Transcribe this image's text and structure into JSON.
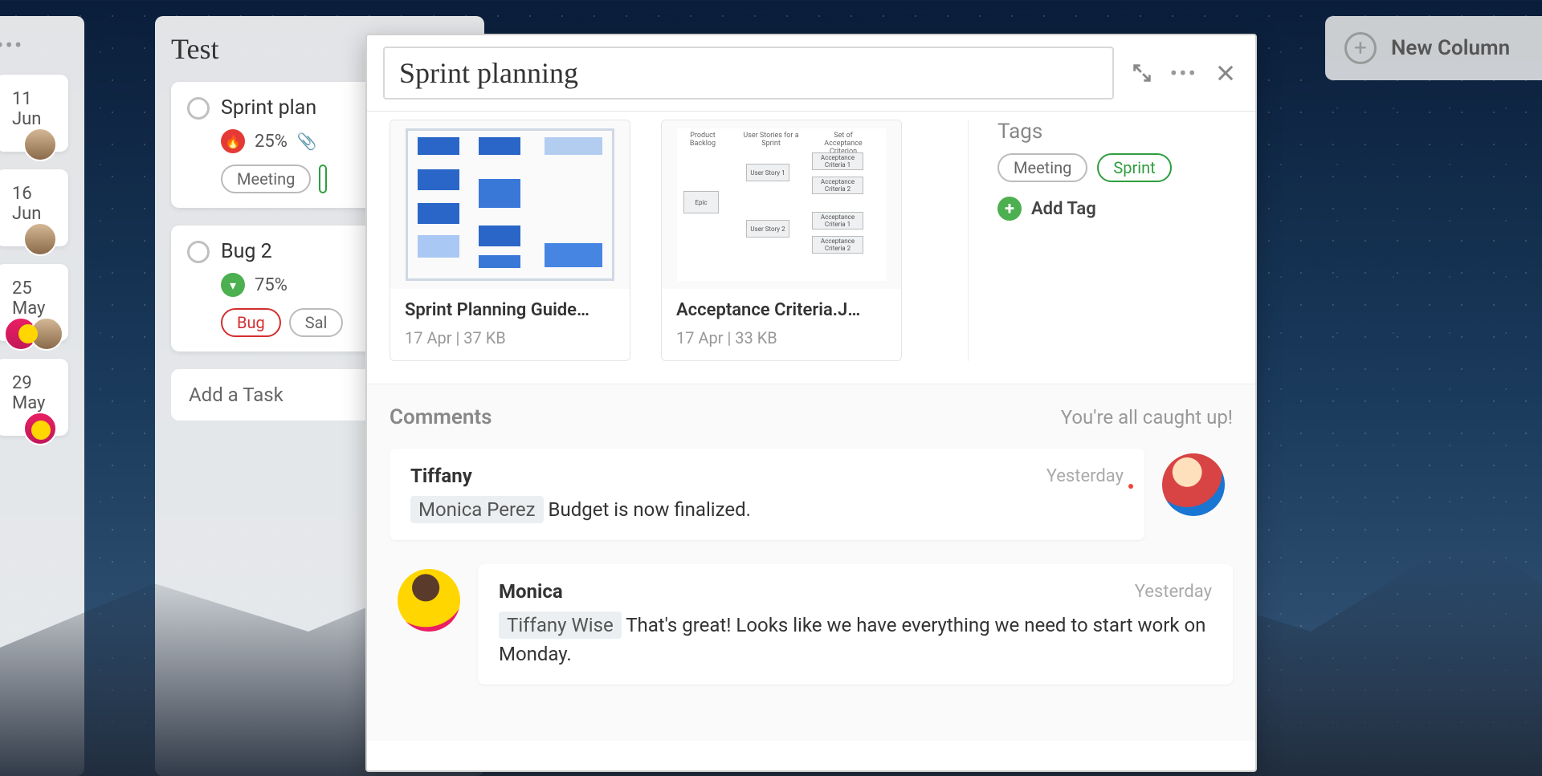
{
  "board": {
    "narrowColumn": {
      "cards": [
        {
          "date": "11 Jun"
        },
        {
          "date": "16 Jun"
        },
        {
          "date": "25 May"
        },
        {
          "date": "29 May"
        }
      ]
    },
    "testColumn": {
      "title": "Test",
      "tasks": [
        {
          "title": "Sprint plan",
          "progress": "25%",
          "priority": "fire",
          "tags": [
            {
              "label": "Meeting",
              "style": "grey"
            }
          ]
        },
        {
          "title": "Bug 2",
          "progress": "75%",
          "priority": "down",
          "tags": [
            {
              "label": "Bug",
              "style": "red"
            },
            {
              "label": "Sal",
              "style": "grey"
            }
          ]
        }
      ],
      "addTask": "Add a Task"
    },
    "newColumn": {
      "label": "New Column"
    }
  },
  "modal": {
    "title": "Sprint planning",
    "attachments": [
      {
        "name": "Sprint Planning Guide…",
        "meta": "17 Apr | 37 KB"
      },
      {
        "name": "Acceptance Criteria.J…",
        "meta": "17 Apr | 33 KB",
        "treeLabels": {
          "col1": "Product Backlog",
          "col2": "User Stories for a Sprint",
          "col3": "Set of Acceptance Criterion",
          "epic": "Epic",
          "us1": "User Story 1",
          "us2": "User Story 2",
          "ac1": "Acceptance Criteria 1",
          "ac2": "Acceptance Criteria 2",
          "ac3": "Acceptance Criteria 1",
          "ac4": "Acceptance Criteria 2"
        }
      }
    ],
    "tags": {
      "heading": "Tags",
      "items": [
        {
          "label": "Meeting",
          "style": "grey"
        },
        {
          "label": "Sprint",
          "style": "green"
        }
      ],
      "addTag": "Add Tag"
    },
    "comments": {
      "heading": "Comments",
      "caughtUp": "You're all caught up!",
      "items": [
        {
          "author": "Tiffany",
          "time": "Yesterday",
          "mention": "Monica  Perez",
          "body": "Budget is now finalized.",
          "side": "right"
        },
        {
          "author": "Monica",
          "time": "Yesterday",
          "mention": "Tiffany Wise",
          "body": "That's great! Looks like we have everything we need to start work on Monday.",
          "side": "left"
        }
      ]
    }
  }
}
